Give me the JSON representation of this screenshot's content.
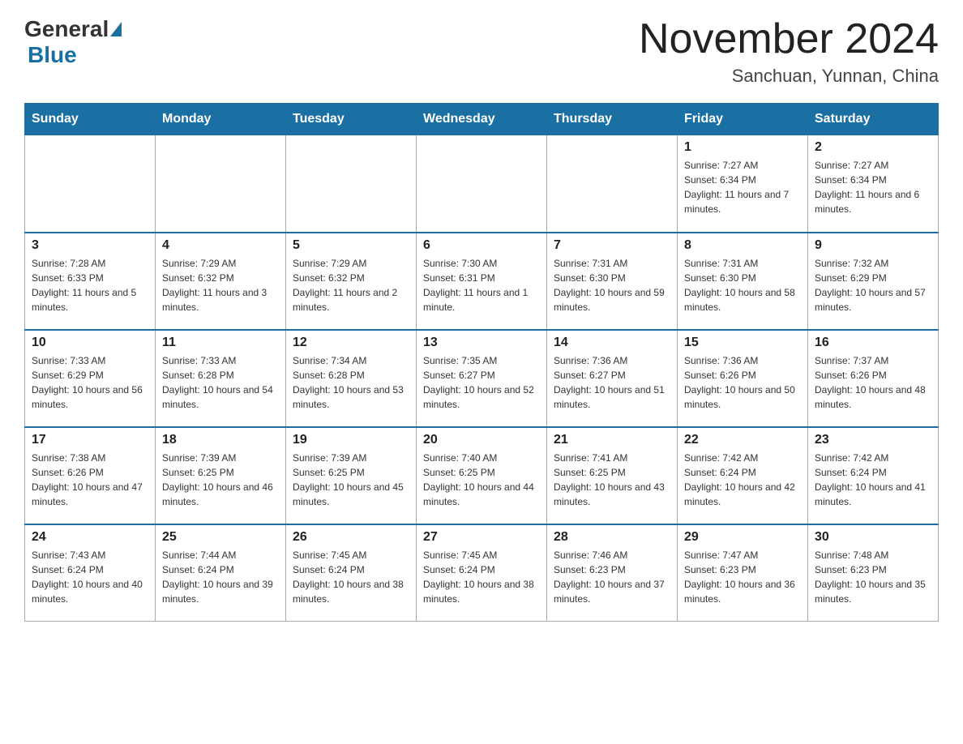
{
  "header": {
    "logo": {
      "general": "General",
      "blue": "Blue"
    },
    "title": "November 2024",
    "location": "Sanchuan, Yunnan, China"
  },
  "weekdays": [
    "Sunday",
    "Monday",
    "Tuesday",
    "Wednesday",
    "Thursday",
    "Friday",
    "Saturday"
  ],
  "weeks": [
    [
      {
        "day": "",
        "info": ""
      },
      {
        "day": "",
        "info": ""
      },
      {
        "day": "",
        "info": ""
      },
      {
        "day": "",
        "info": ""
      },
      {
        "day": "",
        "info": ""
      },
      {
        "day": "1",
        "info": "Sunrise: 7:27 AM\nSunset: 6:34 PM\nDaylight: 11 hours and 7 minutes."
      },
      {
        "day": "2",
        "info": "Sunrise: 7:27 AM\nSunset: 6:34 PM\nDaylight: 11 hours and 6 minutes."
      }
    ],
    [
      {
        "day": "3",
        "info": "Sunrise: 7:28 AM\nSunset: 6:33 PM\nDaylight: 11 hours and 5 minutes."
      },
      {
        "day": "4",
        "info": "Sunrise: 7:29 AM\nSunset: 6:32 PM\nDaylight: 11 hours and 3 minutes."
      },
      {
        "day": "5",
        "info": "Sunrise: 7:29 AM\nSunset: 6:32 PM\nDaylight: 11 hours and 2 minutes."
      },
      {
        "day": "6",
        "info": "Sunrise: 7:30 AM\nSunset: 6:31 PM\nDaylight: 11 hours and 1 minute."
      },
      {
        "day": "7",
        "info": "Sunrise: 7:31 AM\nSunset: 6:30 PM\nDaylight: 10 hours and 59 minutes."
      },
      {
        "day": "8",
        "info": "Sunrise: 7:31 AM\nSunset: 6:30 PM\nDaylight: 10 hours and 58 minutes."
      },
      {
        "day": "9",
        "info": "Sunrise: 7:32 AM\nSunset: 6:29 PM\nDaylight: 10 hours and 57 minutes."
      }
    ],
    [
      {
        "day": "10",
        "info": "Sunrise: 7:33 AM\nSunset: 6:29 PM\nDaylight: 10 hours and 56 minutes."
      },
      {
        "day": "11",
        "info": "Sunrise: 7:33 AM\nSunset: 6:28 PM\nDaylight: 10 hours and 54 minutes."
      },
      {
        "day": "12",
        "info": "Sunrise: 7:34 AM\nSunset: 6:28 PM\nDaylight: 10 hours and 53 minutes."
      },
      {
        "day": "13",
        "info": "Sunrise: 7:35 AM\nSunset: 6:27 PM\nDaylight: 10 hours and 52 minutes."
      },
      {
        "day": "14",
        "info": "Sunrise: 7:36 AM\nSunset: 6:27 PM\nDaylight: 10 hours and 51 minutes."
      },
      {
        "day": "15",
        "info": "Sunrise: 7:36 AM\nSunset: 6:26 PM\nDaylight: 10 hours and 50 minutes."
      },
      {
        "day": "16",
        "info": "Sunrise: 7:37 AM\nSunset: 6:26 PM\nDaylight: 10 hours and 48 minutes."
      }
    ],
    [
      {
        "day": "17",
        "info": "Sunrise: 7:38 AM\nSunset: 6:26 PM\nDaylight: 10 hours and 47 minutes."
      },
      {
        "day": "18",
        "info": "Sunrise: 7:39 AM\nSunset: 6:25 PM\nDaylight: 10 hours and 46 minutes."
      },
      {
        "day": "19",
        "info": "Sunrise: 7:39 AM\nSunset: 6:25 PM\nDaylight: 10 hours and 45 minutes."
      },
      {
        "day": "20",
        "info": "Sunrise: 7:40 AM\nSunset: 6:25 PM\nDaylight: 10 hours and 44 minutes."
      },
      {
        "day": "21",
        "info": "Sunrise: 7:41 AM\nSunset: 6:25 PM\nDaylight: 10 hours and 43 minutes."
      },
      {
        "day": "22",
        "info": "Sunrise: 7:42 AM\nSunset: 6:24 PM\nDaylight: 10 hours and 42 minutes."
      },
      {
        "day": "23",
        "info": "Sunrise: 7:42 AM\nSunset: 6:24 PM\nDaylight: 10 hours and 41 minutes."
      }
    ],
    [
      {
        "day": "24",
        "info": "Sunrise: 7:43 AM\nSunset: 6:24 PM\nDaylight: 10 hours and 40 minutes."
      },
      {
        "day": "25",
        "info": "Sunrise: 7:44 AM\nSunset: 6:24 PM\nDaylight: 10 hours and 39 minutes."
      },
      {
        "day": "26",
        "info": "Sunrise: 7:45 AM\nSunset: 6:24 PM\nDaylight: 10 hours and 38 minutes."
      },
      {
        "day": "27",
        "info": "Sunrise: 7:45 AM\nSunset: 6:24 PM\nDaylight: 10 hours and 38 minutes."
      },
      {
        "day": "28",
        "info": "Sunrise: 7:46 AM\nSunset: 6:23 PM\nDaylight: 10 hours and 37 minutes."
      },
      {
        "day": "29",
        "info": "Sunrise: 7:47 AM\nSunset: 6:23 PM\nDaylight: 10 hours and 36 minutes."
      },
      {
        "day": "30",
        "info": "Sunrise: 7:48 AM\nSunset: 6:23 PM\nDaylight: 10 hours and 35 minutes."
      }
    ]
  ]
}
